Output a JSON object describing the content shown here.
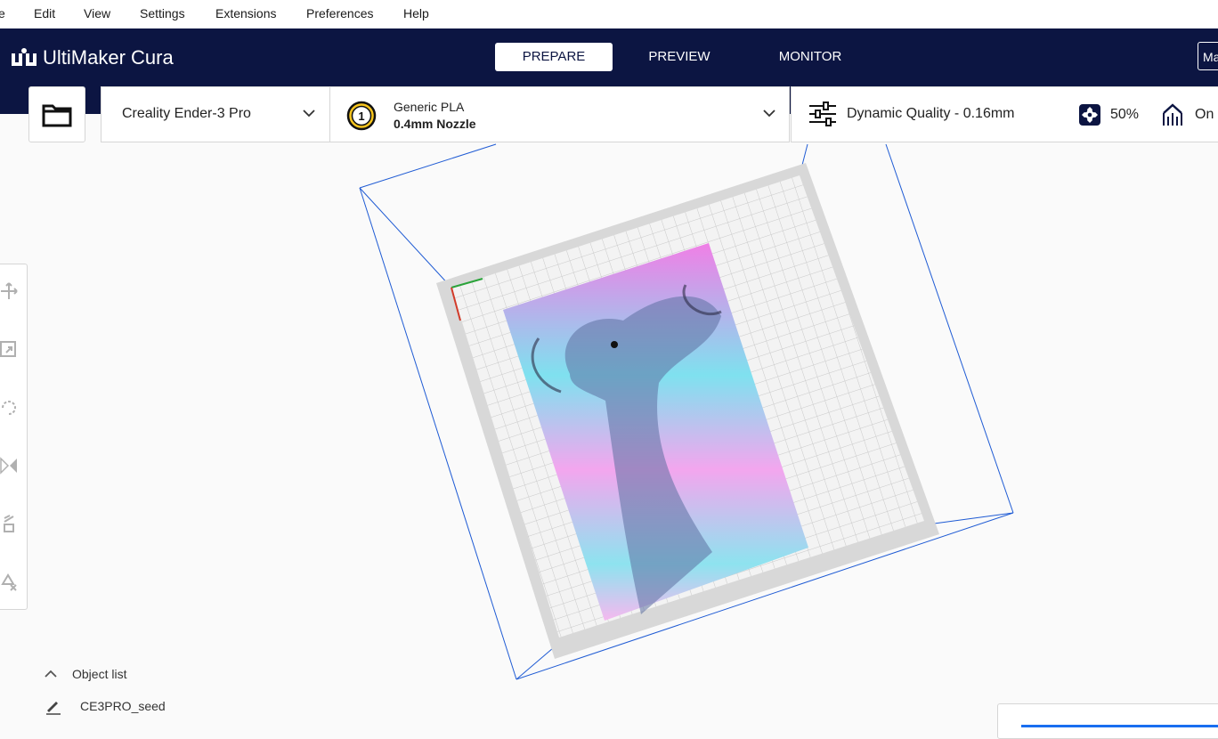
{
  "menu": {
    "items": [
      "e",
      "Edit",
      "View",
      "Settings",
      "Extensions",
      "Preferences",
      "Help"
    ]
  },
  "app": {
    "brand": "UltiMaker Cura"
  },
  "stages": [
    {
      "label": "PREPARE",
      "active": true
    },
    {
      "label": "PREVIEW",
      "active": false
    },
    {
      "label": "MONITOR",
      "active": false
    }
  ],
  "marketplace": {
    "label": "Ma"
  },
  "machine": {
    "name": "Creality Ender-3 Pro"
  },
  "extruder": {
    "number": "1",
    "material": "Generic PLA",
    "nozzle": "0.4mm Nozzle"
  },
  "print_settings": {
    "profile": "Dynamic Quality - 0.16mm",
    "infill": "50%",
    "support": "On"
  },
  "object_list": {
    "title": "Object list",
    "items": [
      "CE3PRO_seed"
    ]
  },
  "colors": {
    "header": "#0c1542",
    "accent": "#196ef0",
    "viewport": "#fafafa"
  },
  "icons": [
    "open-folder-icon",
    "chevron-down-icon",
    "print-settings-icon",
    "infill-icon",
    "support-icon",
    "move-icon",
    "scale-icon",
    "rotate-icon",
    "mirror-icon",
    "per-model-settings-icon",
    "support-blocker-icon",
    "pencil-icon",
    "chevron-up-icon"
  ]
}
